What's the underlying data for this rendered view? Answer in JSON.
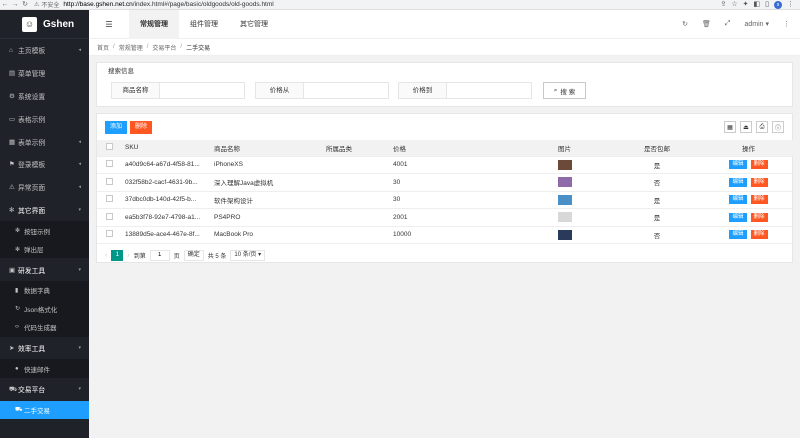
{
  "browser": {
    "security": "不安全",
    "url_host": "http://base.gshen.net.cn",
    "url_path": "/index.html#/page/basic/oldgoods/old-goods.html",
    "profile_initial": "s"
  },
  "sidebar": {
    "logo_text": "Gshen",
    "items": [
      {
        "label": "主页模板",
        "icon": "home-icon",
        "glyph": "⌂",
        "arrow": "◂"
      },
      {
        "label": "菜单管理",
        "icon": "menu-icon",
        "glyph": "▤",
        "arrow": ""
      },
      {
        "label": "系统设置",
        "icon": "gear-icon",
        "glyph": "⚙",
        "arrow": ""
      },
      {
        "label": "表格示例",
        "icon": "file-icon",
        "glyph": "▭",
        "arrow": ""
      },
      {
        "label": "表单示例",
        "icon": "calendar-icon",
        "glyph": "▦",
        "arrow": "◂"
      },
      {
        "label": "登录模板",
        "icon": "flag-icon",
        "glyph": "⚑",
        "arrow": "◂"
      },
      {
        "label": "异常页面",
        "icon": "warning-icon",
        "glyph": "⚠",
        "arrow": "◂"
      },
      {
        "label": "其它界面",
        "icon": "snowflake-icon",
        "glyph": "✻",
        "arrow": "▾"
      }
    ],
    "sub_other": [
      {
        "label": "按钮示例",
        "icon": "snowflake-icon",
        "glyph": "✻"
      },
      {
        "label": "弹出层",
        "icon": "snowflake-icon",
        "glyph": "✻"
      }
    ],
    "dev_tools": {
      "label": "研发工具",
      "icon": "briefcase-icon",
      "glyph": "▣",
      "arrow": "▾"
    },
    "sub_dev": [
      {
        "label": "数据字典",
        "icon": "book-icon",
        "glyph": "▮"
      },
      {
        "label": "Json格式化",
        "icon": "refresh-icon",
        "glyph": "↻"
      },
      {
        "label": "代码生成器",
        "icon": "code-icon",
        "glyph": "‹›"
      }
    ],
    "efficiency": {
      "label": "效率工具",
      "icon": "send-icon",
      "glyph": "➤",
      "arrow": "▾"
    },
    "sub_eff": [
      {
        "label": "快速邮件",
        "icon": "chat-icon",
        "glyph": "●"
      }
    ],
    "trade": {
      "label": "交易平台",
      "icon": "cart-icon",
      "glyph": "⛟",
      "arrow": "▾"
    },
    "sub_trade": [
      {
        "label": "二手交易",
        "icon": "cart-icon",
        "glyph": "⛟"
      }
    ]
  },
  "header": {
    "tabs": [
      "常规管理",
      "组件管理",
      "其它管理"
    ],
    "user": "admin"
  },
  "breadcrumb": [
    "首页",
    "常规管理",
    "交易平台",
    "二手交易"
  ],
  "search": {
    "legend": "搜索信息",
    "name_label": "商品名称",
    "price_from_label": "价格从",
    "price_to_label": "价格到",
    "button": "搜 索"
  },
  "toolbar": {
    "add": "添加",
    "delete": "删除"
  },
  "table": {
    "headers": [
      "SKU",
      "商品名称",
      "所属品类",
      "价格",
      "图片",
      "是否包邮",
      "操作"
    ],
    "rows": [
      {
        "sku": "a40d9c64-a67d-4f58-81...",
        "name": "iPhoneXS",
        "category": "",
        "price": "4001",
        "shipping": "是",
        "thumb": "#6b4a3a"
      },
      {
        "sku": "032f58b2-cacf-4631-9b...",
        "name": "深入理解Java虚拟机",
        "category": "",
        "price": "30",
        "shipping": "否",
        "thumb": "#8f6aa8"
      },
      {
        "sku": "37dbc0db-140d-42f5-b...",
        "name": "软件架构设计",
        "category": "",
        "price": "30",
        "shipping": "是",
        "thumb": "#4a90c8"
      },
      {
        "sku": "ea5b3f78-92e7-4798-a1...",
        "name": "PS4PRO",
        "category": "",
        "price": "2001",
        "shipping": "是",
        "thumb": "#d8d8d8"
      },
      {
        "sku": "13889d5e-ace4-467e-8f...",
        "name": "MacBook Pro",
        "category": "",
        "price": "10000",
        "shipping": "否",
        "thumb": "#2a3a5a"
      }
    ],
    "edit": "编辑",
    "del": "删除"
  },
  "pager": {
    "current": "1",
    "goto_label": "到第",
    "page_value": "1",
    "page_unit": "页",
    "confirm": "确定",
    "total": "共 5 条",
    "size": "10 条/页"
  }
}
